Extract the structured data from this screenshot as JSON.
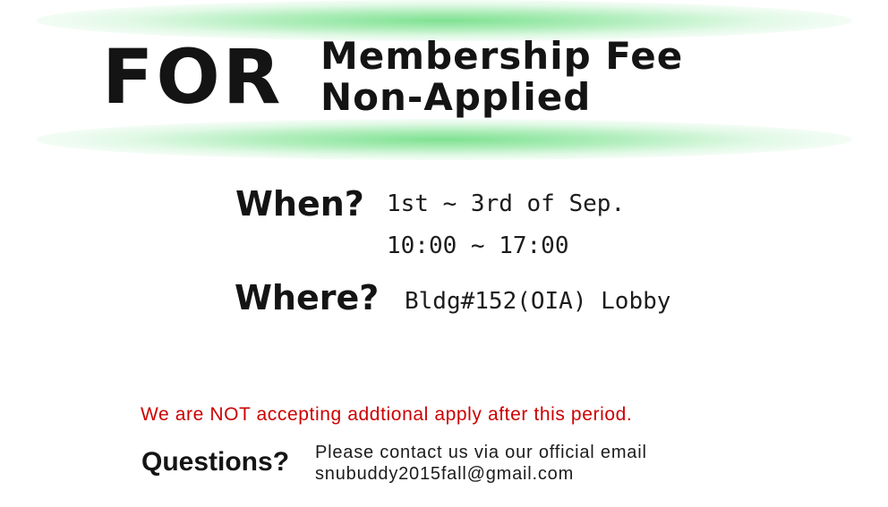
{
  "header": {
    "for_label": "FOR",
    "title_line_1": "Membership Fee",
    "title_line_2": "Non-Applied"
  },
  "schedule": {
    "when_label": "When?",
    "date": "1st ~ 3rd of Sep.",
    "time": "10:00 ~ 17:00",
    "where_label": "Where?",
    "place": "Bldg#152(OIA) Lobby"
  },
  "notice": {
    "text": "We are NOT accepting addtional apply after this period."
  },
  "contact": {
    "questions_label": "Questions?",
    "line_1": "Please contact us via our official email",
    "email": "snubuddy2015fall@gmail.com"
  },
  "colors": {
    "glow": "#78e08c",
    "notice": "#cc0000",
    "text": "#141414",
    "background": "#ffffff"
  }
}
